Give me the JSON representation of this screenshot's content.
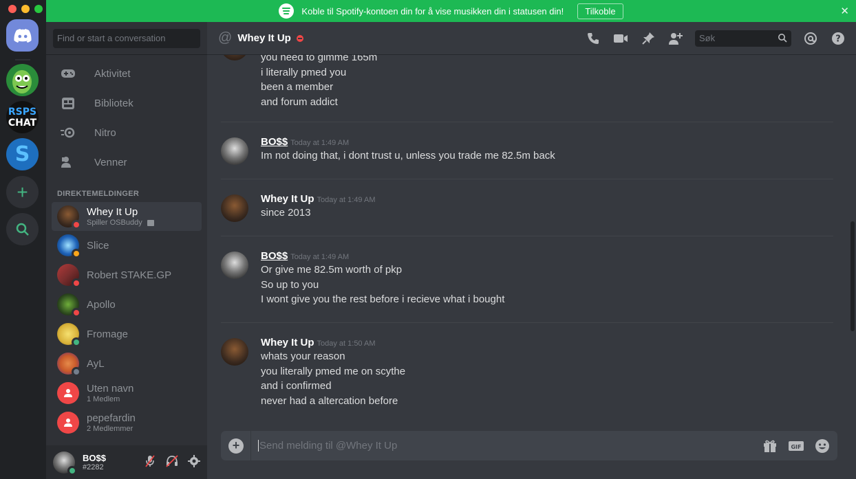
{
  "banner": {
    "text": "Koble til Spotify-kontoen din for å vise musikken din i statusen din!",
    "button": "Tilkoble",
    "close": "✕"
  },
  "guilds": [
    {
      "name": "rick-and-morty-server",
      "color": "#2a8c3a"
    },
    {
      "name": "rsps-chat",
      "label_top": "RSPS",
      "label_bottom": "CHAT",
      "color": "#111111"
    },
    {
      "name": "s-server",
      "label": "S",
      "color": "#1e6fbf"
    }
  ],
  "sidebar": {
    "search_placeholder": "Find or start a conversation",
    "nav": [
      {
        "label": "Aktivitet",
        "icon": "gamepad-icon"
      },
      {
        "label": "Bibliotek",
        "icon": "library-icon"
      },
      {
        "label": "Nitro",
        "icon": "nitro-icon"
      },
      {
        "label": "Venner",
        "icon": "friends-icon"
      }
    ],
    "dm_header": "DIREKTEMELDINGER",
    "dms": [
      {
        "name": "Whey It Up",
        "sub": "Spiller OSBuddy",
        "status": "#f04747",
        "avatar": "#3b2a1f",
        "active": true
      },
      {
        "name": "Slice",
        "sub": "",
        "status": "#faa61a",
        "avatar": "#1f63b8"
      },
      {
        "name": "Robert STAKE.GP",
        "sub": "",
        "status": "#f04747",
        "avatar": "#7a2e2e"
      },
      {
        "name": "Apollo",
        "sub": "",
        "status": "#f04747",
        "avatar": "#2d4a1e"
      },
      {
        "name": "Fromage",
        "sub": "",
        "status": "#43b581",
        "avatar": "#d9b23a"
      },
      {
        "name": "AyL",
        "sub": "",
        "status": "#747f8d",
        "avatar": "#c95a2a"
      },
      {
        "name": "Uten navn",
        "sub": "1 Medlem",
        "status": "",
        "avatar": "#f04747"
      },
      {
        "name": "pepefardin",
        "sub": "2 Medlemmer",
        "status": "",
        "avatar": "#f04747"
      }
    ]
  },
  "user": {
    "name": "BO$$",
    "tag": "#2282"
  },
  "chat": {
    "channel": "Whey It Up",
    "search_placeholder": "Søk",
    "input_placeholder": "Send melding til @Whey It Up",
    "groups": [
      {
        "author": "",
        "time": "",
        "lines": [
          "you need to gimme 165m",
          "i literally pmed you",
          "been a member",
          "and forum addict"
        ]
      },
      {
        "author": "BO$$",
        "time": "Today at 1:49 AM",
        "lines": [
          "Im not doing that, i dont trust u, unless you trade me 82.5m back"
        ]
      },
      {
        "author": "Whey It Up",
        "time": "Today at 1:49 AM",
        "lines": [
          "since 2013"
        ]
      },
      {
        "author": "BO$$",
        "time": "Today at 1:49 AM",
        "lines": [
          "Or give me 82.5m worth of pkp",
          "So up to you",
          "I wont give you the rest before i recieve what i bought"
        ]
      },
      {
        "author": "Whey It Up",
        "time": "Today at 1:50 AM",
        "lines": [
          "whats your reason",
          "you literally pmed me on scythe",
          "and i confirmed",
          "never had a altercation before"
        ]
      }
    ]
  },
  "colors": {
    "spotify_green": "#1db954",
    "blurple": "#7289da",
    "dnd": "#f04747",
    "online": "#43b581",
    "idle": "#faa61a"
  }
}
